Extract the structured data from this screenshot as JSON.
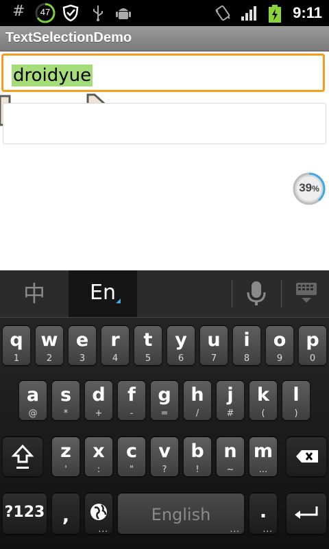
{
  "status_bar": {
    "hash": "#",
    "notification_count": "47",
    "time": "9:11",
    "icons": [
      "hash-icon",
      "notification-count-ring",
      "shield-icon",
      "usb-icon",
      "android-debug-icon",
      "vibrate-icon",
      "signal-icon",
      "battery-charging-icon"
    ]
  },
  "app": {
    "title": "TextSelectionDemo"
  },
  "fields": {
    "first": {
      "selected_text": "droidyue"
    },
    "second": {
      "value": ""
    }
  },
  "progress_badge": {
    "value": "39",
    "unit": "%",
    "fraction": 0.39
  },
  "keyboard": {
    "toolbar": {
      "tab_zh": "中",
      "tab_en": "En"
    },
    "row1": [
      {
        "main": "q",
        "sub": "1"
      },
      {
        "main": "w",
        "sub": "2"
      },
      {
        "main": "e",
        "sub": "3"
      },
      {
        "main": "r",
        "sub": "4"
      },
      {
        "main": "t",
        "sub": "5"
      },
      {
        "main": "y",
        "sub": "6"
      },
      {
        "main": "u",
        "sub": "7"
      },
      {
        "main": "i",
        "sub": "8"
      },
      {
        "main": "o",
        "sub": "9"
      },
      {
        "main": "p",
        "sub": "0"
      }
    ],
    "row2": [
      {
        "main": "a",
        "sub": "@"
      },
      {
        "main": "s",
        "sub": "*"
      },
      {
        "main": "d",
        "sub": "+"
      },
      {
        "main": "f",
        "sub": "-"
      },
      {
        "main": "g",
        "sub": "="
      },
      {
        "main": "h",
        "sub": "/"
      },
      {
        "main": "j",
        "sub": "#"
      },
      {
        "main": "k",
        "sub": "("
      },
      {
        "main": "l",
        "sub": ")"
      }
    ],
    "row3": [
      {
        "main": "z",
        "sub": "'"
      },
      {
        "main": "x",
        "sub": ":"
      },
      {
        "main": "c",
        "sub": "\""
      },
      {
        "main": "v",
        "sub": "?"
      },
      {
        "main": "b",
        "sub": "!"
      },
      {
        "main": "n",
        "sub": "~"
      },
      {
        "main": "m",
        "sub": "..."
      }
    ],
    "row4": {
      "symbols": "?123",
      "comma": ",",
      "space": "English",
      "period": ".",
      "more": "..."
    },
    "colors": {
      "accent": "#3da9e6",
      "key_top": "#5f5f5f",
      "key_bottom": "#3e3e3e"
    }
  },
  "colors": {
    "focus_border": "#f39c1d",
    "selection": "#a6dd7b",
    "handle": "#efe3d3"
  }
}
